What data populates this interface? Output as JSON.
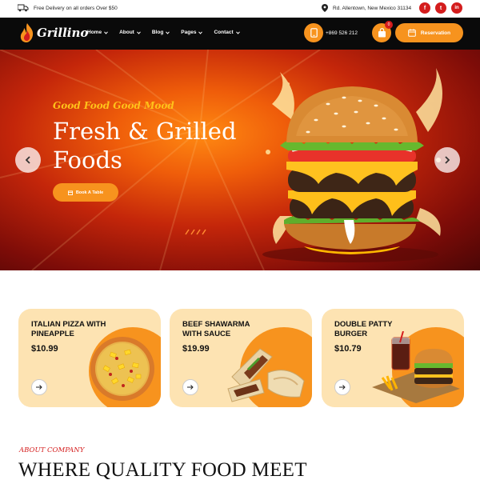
{
  "topbar": {
    "delivery_text": "Free Delivery on all orders Over $50",
    "address_text": "Rd. Allentown, New Mexico 31134",
    "social": [
      {
        "icon": "facebook-icon",
        "glyph": "f"
      },
      {
        "icon": "twitter-icon",
        "glyph": "t"
      },
      {
        "icon": "linkedin-icon",
        "glyph": "in"
      }
    ]
  },
  "nav": {
    "logo_text": "Grillino",
    "menu": [
      {
        "label": "Home"
      },
      {
        "label": "About"
      },
      {
        "label": "Blog"
      },
      {
        "label": "Pages"
      },
      {
        "label": "Contact"
      }
    ],
    "phone": "+869 526 212",
    "cart_count": "0",
    "reservation_label": "Reservation"
  },
  "hero": {
    "tagline": "Good Food Good Mood",
    "title_line1": "Fresh & Grilled",
    "title_line2": "Foods",
    "book_label": "Book A Table"
  },
  "products": [
    {
      "title_line1": "ITALIAN PIZZA WITH",
      "title_line2": "PINEAPPLE",
      "price": "$10.99"
    },
    {
      "title_line1": "BEEF SHAWARMA",
      "title_line2": "WITH SAUCE",
      "price": "$19.99"
    },
    {
      "title_line1": "DOUBLE PATTY",
      "title_line2": "BURGER",
      "price": "$10.79"
    }
  ],
  "about": {
    "tag": "ABOUT COMPANY",
    "title": "WHERE QUALITY FOOD MEET"
  },
  "colors": {
    "accent": "#f7931e",
    "brand_red": "#d41d1d",
    "card_bg": "#fde3b2",
    "tagline": "#ffc21a"
  }
}
